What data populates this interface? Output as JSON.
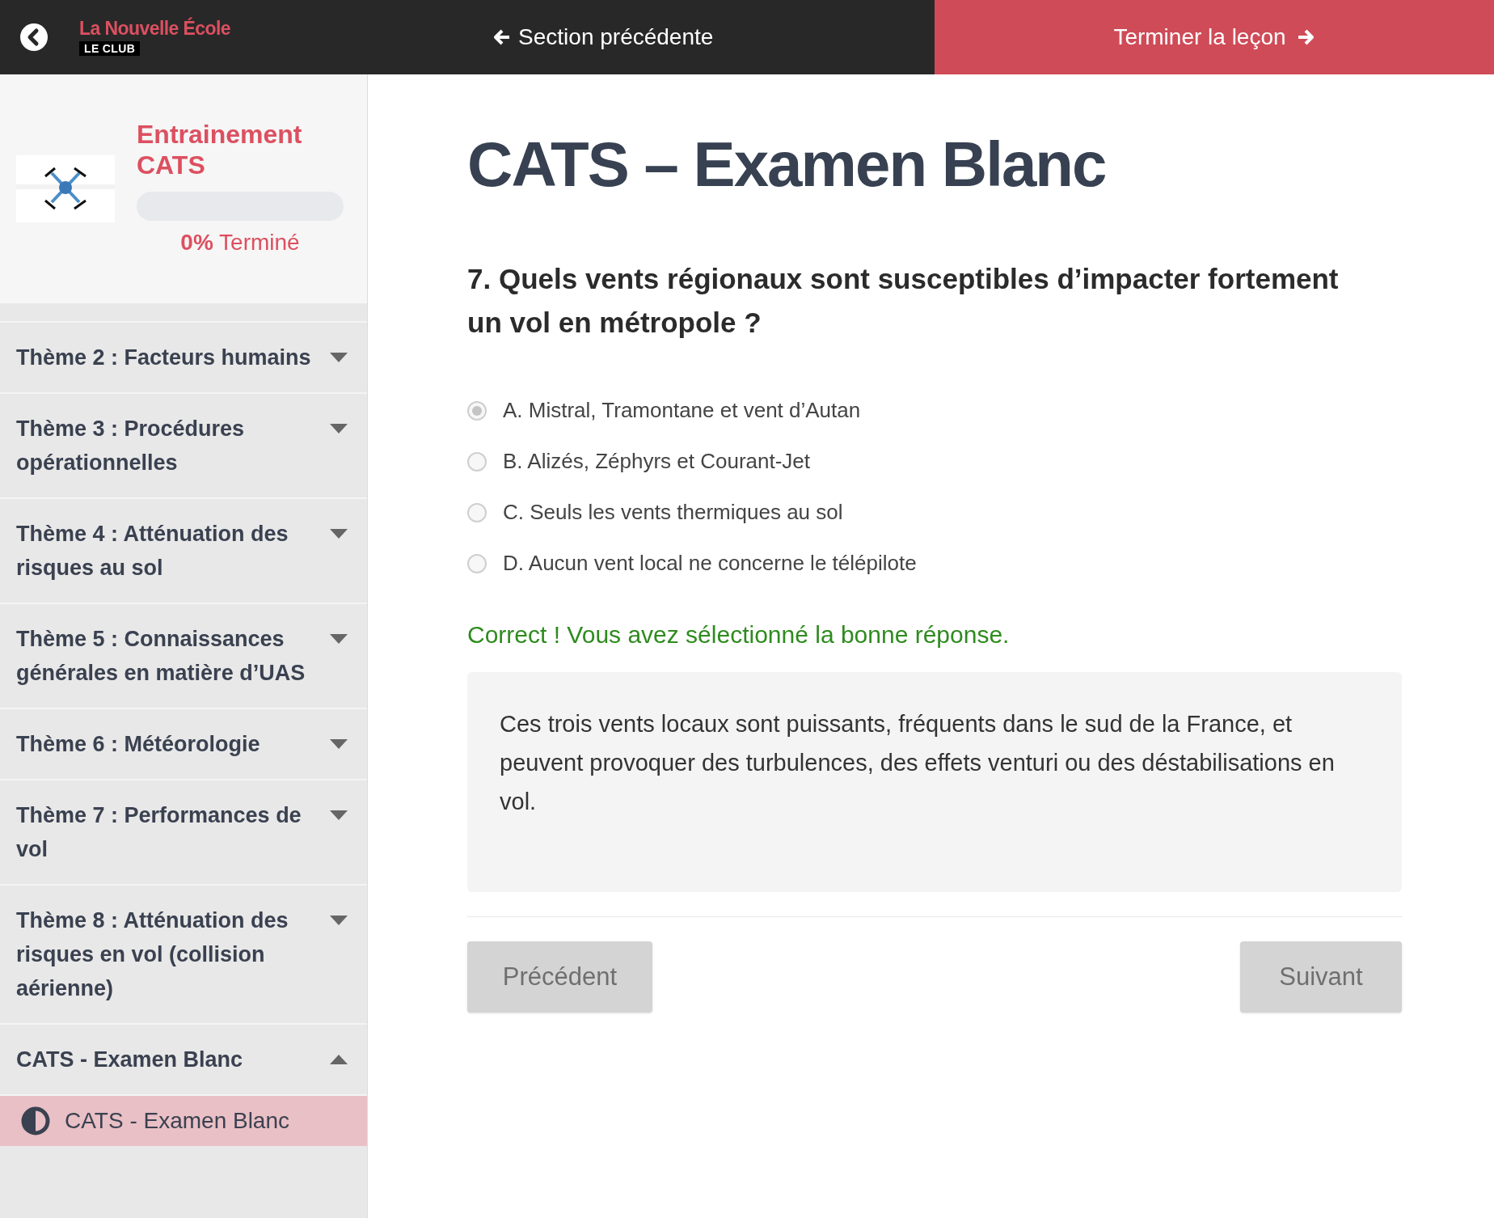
{
  "header": {
    "brand": "La Nouvelle École",
    "brand_tag": "LE CLUB",
    "prev_section": "Section précédente",
    "finish": "Terminer la leçon"
  },
  "course": {
    "title": "Entrainement CATS",
    "progress": {
      "level": 0,
      "percent": "0%",
      "label": "Terminé"
    }
  },
  "sidebar": {
    "items": [
      {
        "label": "Thème 2 : Facteurs humains",
        "expanded": false
      },
      {
        "label": "Thème 3 : Procédures opérationnelles",
        "expanded": false
      },
      {
        "label": "Thème 4 : Atténuation des risques au sol",
        "expanded": false
      },
      {
        "label": "Thème 5 : Connaissances générales en matière d’UAS",
        "expanded": false
      },
      {
        "label": "Thème 6 : Météorologie",
        "expanded": false
      },
      {
        "label": "Thème 7 : Performances de vol",
        "expanded": false
      },
      {
        "label": "Thème 8 : Atténuation des risques en vol (collision aérienne)",
        "expanded": false
      },
      {
        "label": "CATS - Examen Blanc",
        "expanded": true,
        "children": [
          {
            "label": "CATS - Examen Blanc",
            "selected": true
          }
        ]
      }
    ]
  },
  "main": {
    "title": "CATS – Examen Blanc",
    "question_number": "7.",
    "question": "Quels vents régionaux sont susceptibles d’impacter fortement un vol en métropole ?",
    "options": [
      {
        "label": "A. Mistral, Tramontane et vent d’Autan",
        "selected": true
      },
      {
        "label": "B. Alizés, Zéphyrs et Courant-Jet",
        "selected": false
      },
      {
        "label": "C. Seuls les vents thermiques au sol",
        "selected": false
      },
      {
        "label": "D. Aucun vent local ne concerne le télépilote",
        "selected": false
      }
    ],
    "feedback": "Correct ! Vous avez sélectionné la bonne réponse.",
    "explanation": "Ces trois vents locaux sont puissants, fréquents dans le sud de la France, et peuvent provoquer des turbulences, des effets venturi ou des déstabilisations en vol.",
    "buttons": {
      "previous": "Précédent",
      "next": "Suivant"
    }
  }
}
